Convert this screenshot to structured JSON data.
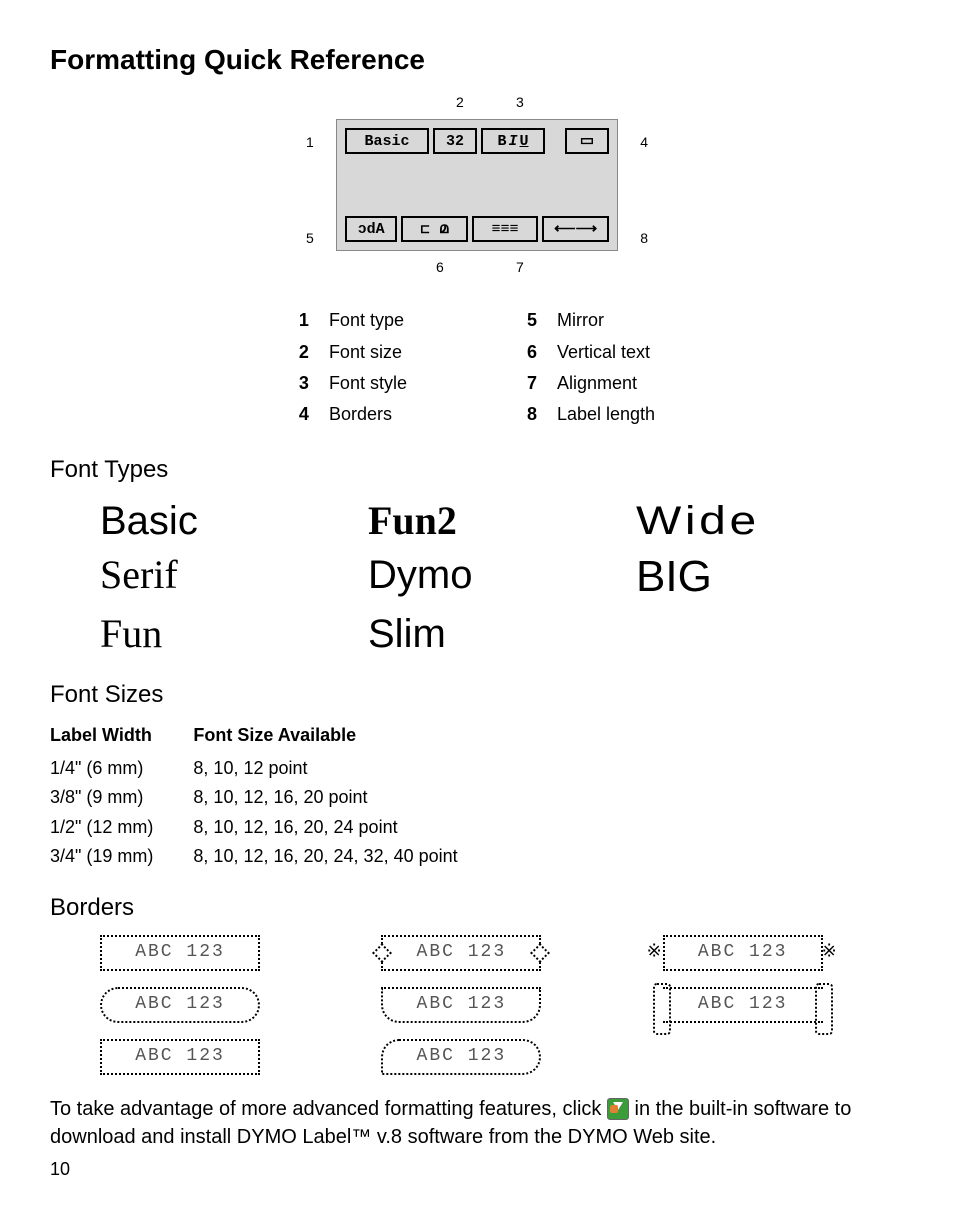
{
  "title": "Formatting Quick Reference",
  "diagram": {
    "top_cells": {
      "basic": "Basic",
      "size": "32",
      "style": "B I U",
      "border": "□"
    },
    "bot_cells": {
      "mirror": "ɔdA",
      "vertical": "⊏ മ ʊ",
      "align": "≡ ≡ ≡",
      "length": "⟵L⟶"
    },
    "callouts": {
      "c1": "1",
      "c2": "2",
      "c3": "3",
      "c4": "4",
      "c5": "5",
      "c6": "6",
      "c7": "7",
      "c8": "8"
    }
  },
  "legend": {
    "left": [
      {
        "n": "1",
        "label": "Font type"
      },
      {
        "n": "2",
        "label": "Font size"
      },
      {
        "n": "3",
        "label": "Font style"
      },
      {
        "n": "4",
        "label": "Borders"
      }
    ],
    "right": [
      {
        "n": "5",
        "label": "Mirror"
      },
      {
        "n": "6",
        "label": "Vertical text"
      },
      {
        "n": "7",
        "label": "Alignment"
      },
      {
        "n": "8",
        "label": "Label length"
      }
    ]
  },
  "sections": {
    "font_types": "Font Types",
    "font_sizes": "Font Sizes",
    "borders": "Borders"
  },
  "font_types": {
    "basic": "Basic",
    "serif": "Serif",
    "fun": "Fun",
    "fun2": "Fun2",
    "dymo": "Dymo",
    "slim": "Slim",
    "wide": "Wide",
    "big": "BIG"
  },
  "font_sizes": {
    "headers": {
      "width": "Label Width",
      "sizes": "Font Size Available"
    },
    "rows": [
      {
        "width": "1/4\" (6 mm)",
        "sizes": "8, 10, 12 point"
      },
      {
        "width": "3/8\" (9 mm)",
        "sizes": "8, 10, 12, 16, 20 point"
      },
      {
        "width": "1/2\" (12 mm)",
        "sizes": "8, 10, 12, 16, 20, 24 point"
      },
      {
        "width": "3/4\" (19 mm)",
        "sizes": "8, 10, 12, 16, 20, 24, 32, 40 point"
      }
    ]
  },
  "border_sample_text": "ABC 123",
  "footer": {
    "pre": "To take advantage of more advanced formatting features, click ",
    "post": " in the built-in software to download and install DYMO Label™ v.8 software from the DYMO Web site."
  },
  "page_number": "10"
}
